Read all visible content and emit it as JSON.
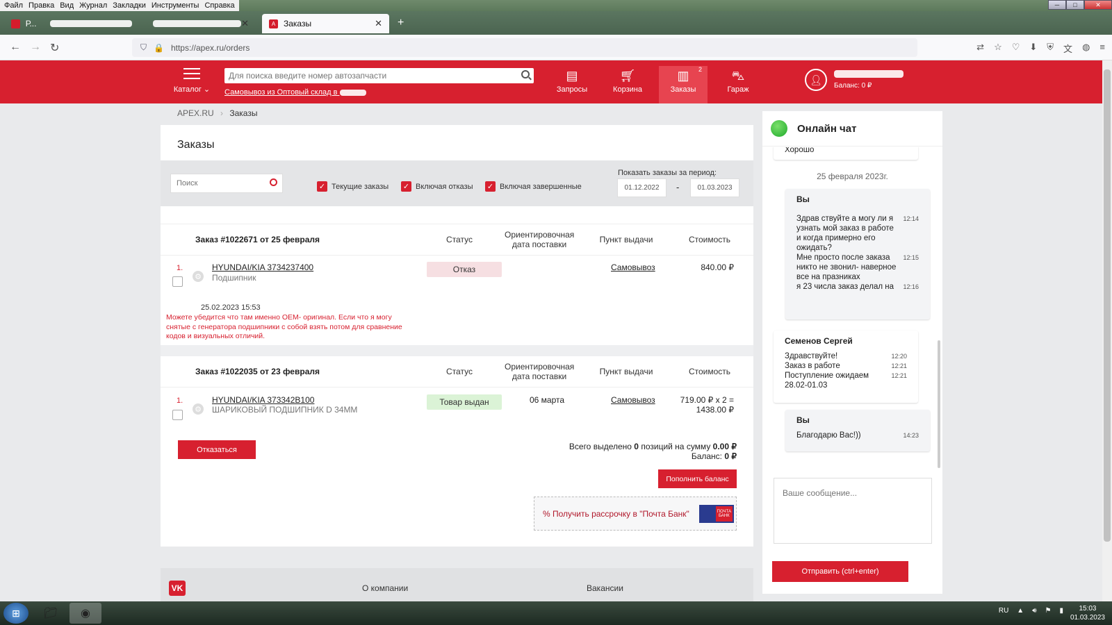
{
  "menubar": {
    "items": [
      "Файл",
      "Правка",
      "Вид",
      "Журнал",
      "Закладки",
      "Инструменты",
      "Справка"
    ]
  },
  "tabs": {
    "inactive_label": "Р...",
    "active_label": "Заказы"
  },
  "browser": {
    "url": "https://apex.ru/orders"
  },
  "header": {
    "catalog_label": "Каталог",
    "search_placeholder": "Для поиска введите номер автозапчасти",
    "pickup_text": "Самовывоз из Оптовый склад в",
    "nav": [
      {
        "label": "Запросы"
      },
      {
        "label": "Корзина"
      },
      {
        "label": "Заказы",
        "badge": "2"
      },
      {
        "label": "Гараж"
      }
    ],
    "balance": "Баланс: 0 ₽"
  },
  "breadcrumb": {
    "root": "APEX.RU",
    "current": "Заказы"
  },
  "page": {
    "title": "Заказы"
  },
  "filters": {
    "search_placeholder": "Поиск",
    "current_orders": "Текущие заказы",
    "incl_refusals": "Включая отказы",
    "incl_completed": "Включая завершенные",
    "period_label": "Показать заказы за период:",
    "date_from": "01.12.2022",
    "date_to": "01.03.2023",
    "dash": "-"
  },
  "columns": {
    "status": "Статус",
    "delivery": "Ориентировочная дата поставки",
    "pickup": "Пункт выдачи",
    "cost": "Стоимость"
  },
  "orders": [
    {
      "title": "Заказ #1022671 от 25 февраля",
      "item": {
        "num": "1.",
        "part": "HYUNDAI/KIA 3734237400",
        "desc": "Подшипник",
        "status": "Отказ",
        "delivery": "",
        "pickup": "Самовывоз",
        "price": "840.00 ₽"
      },
      "message_date": "25.02.2023 15:53",
      "message": "Можете убедится что там именно OEM- оригинал. Если что я могу снятые с генератора подшипники с собой взять потом для сравнение кодов и визуальных отличий."
    },
    {
      "title": "Заказ #1022035 от 23 февраля",
      "item": {
        "num": "1.",
        "part": "HYUNDAI/KIA 373342B100",
        "desc": "ШАРИКОВЫЙ ПОДШИПНИК D 34ММ",
        "status": "Товар выдан",
        "delivery": "06 марта",
        "pickup": "Самовывоз",
        "price_line1": "719.00 ₽ x 2 =",
        "price_line2": "1438.00 ₽"
      }
    }
  ],
  "actions": {
    "refuse": "Отказаться",
    "totals_prefix": "Всего выделено",
    "totals_count": "0",
    "totals_mid": "позиций на сумму",
    "totals_sum": "0.00 ₽",
    "balance_label": "Баланс:",
    "balance_value": "0 ₽",
    "topup": "Пополнить баланс",
    "installment": "% Получить рассрочку в \"Почта Банк\"",
    "bank_logo": "ПОЧТА БАНК"
  },
  "footer": {
    "vk": "VK",
    "about": "О компании",
    "jobs": "Вакансии"
  },
  "chat": {
    "title": "Онлайн чат",
    "prev_text": "Хорошо",
    "date": "25 февраля 2023г.",
    "msg1": {
      "who": "Вы",
      "lines": [
        {
          "text": "Здрав ствуйте а могу ли я узнать мой заказ в работе и когда примерно его ожидать?",
          "time": "12:14"
        },
        {
          "text": "Мне просто после заказа никто не звонил- наверное все на празниках",
          "time": "12:15"
        },
        {
          "text": "я 23 числа заказ делал на",
          "time": "12:16"
        }
      ]
    },
    "msg2": {
      "who": "Семенов Сергей",
      "lines": [
        {
          "text": "Здравствуйте!",
          "time": "12:20"
        },
        {
          "text": "Заказ в работе",
          "time": "12:21"
        },
        {
          "text": "Поступление ожидаем 28.02-01.03",
          "time": "12:21"
        }
      ]
    },
    "msg3": {
      "who": "Вы",
      "lines": [
        {
          "text": "Благодарю Вас!))",
          "time": "14:23"
        }
      ]
    },
    "input_placeholder": "Ваше сообщение...",
    "send": "Отправить (ctrl+enter)"
  },
  "taskbar": {
    "lang": "RU",
    "time": "15:03",
    "date": "01.03.2023"
  }
}
